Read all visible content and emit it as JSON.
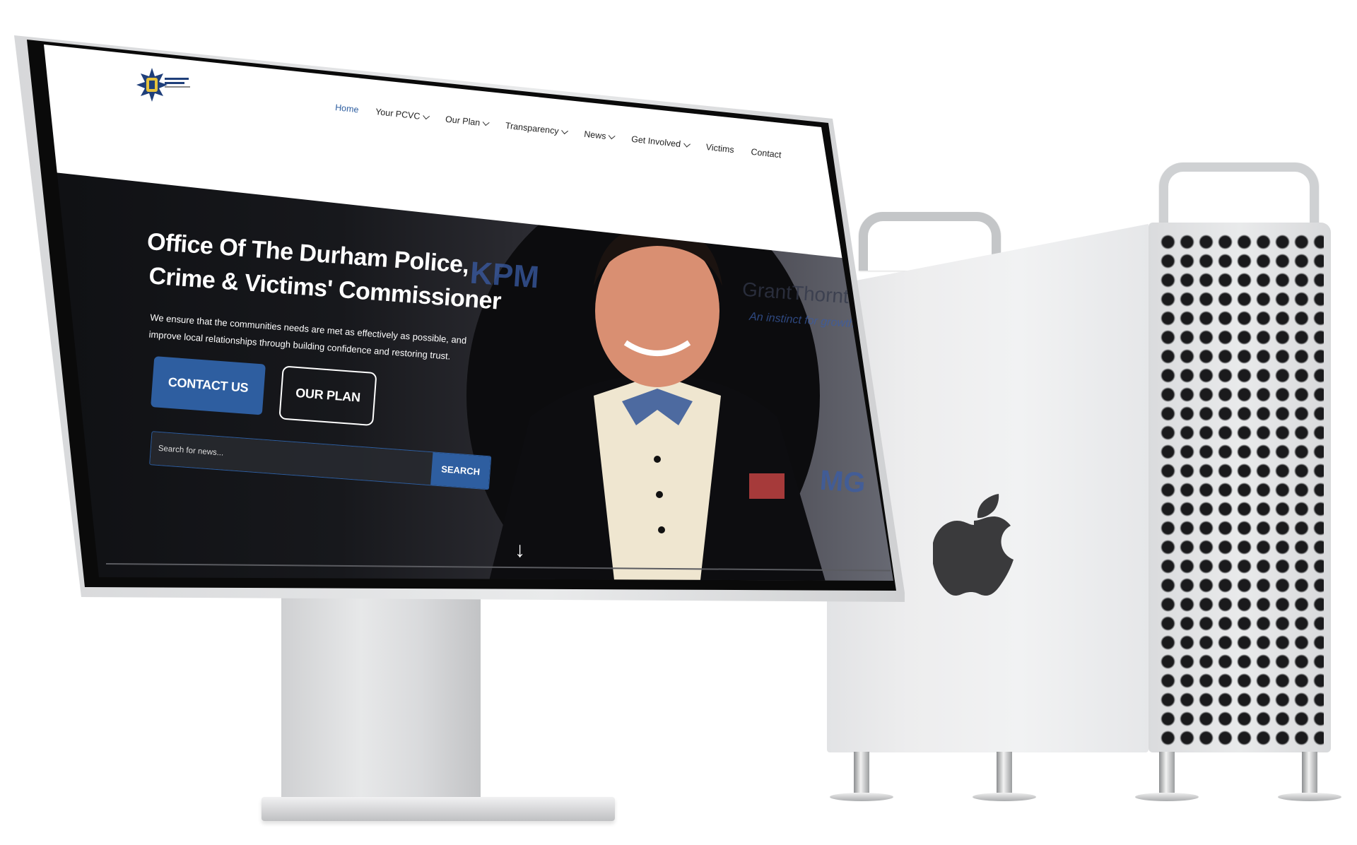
{
  "site": {
    "logo_alt": "Office of the Durham Police, Crime and Victims' Commissioner",
    "nav": [
      {
        "label": "Home",
        "active": true,
        "dropdown": false
      },
      {
        "label": "Your PCVC",
        "active": false,
        "dropdown": true
      },
      {
        "label": "Our Plan",
        "active": false,
        "dropdown": true
      },
      {
        "label": "Transparency",
        "active": false,
        "dropdown": true
      },
      {
        "label": "News",
        "active": false,
        "dropdown": true
      },
      {
        "label": "Get Involved",
        "active": false,
        "dropdown": true
      },
      {
        "label": "Victims",
        "active": false,
        "dropdown": false
      },
      {
        "label": "Contact",
        "active": false,
        "dropdown": false
      }
    ],
    "hero": {
      "title_line1": "Office Of The Durham Police,",
      "title_line2": "Crime & Victims' Commissioner",
      "subtitle": "We ensure that the communities needs are met as effectively as possible, and improve local relationships through building confidence and restoring trust.",
      "contact_button": "CONTACT US",
      "plan_button": "OUR PLAN",
      "search_placeholder": "Search for news...",
      "search_button": "SEARCH",
      "scroll_icon": "arrow-down-icon"
    },
    "backdrop_logos": {
      "kpmg_left": "KPM",
      "grant_thornton": "GrantThornton",
      "grant_thornton_tagline": "An instinct for growth",
      "kpmg_right": "MG"
    }
  },
  "colors": {
    "brand_blue": "#2e5ea0",
    "hero_dark": "#0f1013",
    "silver": "#e6e7e9"
  },
  "icons": {
    "apple_logo": "apple-logo-icon",
    "chevron": "chevron-down-icon"
  }
}
